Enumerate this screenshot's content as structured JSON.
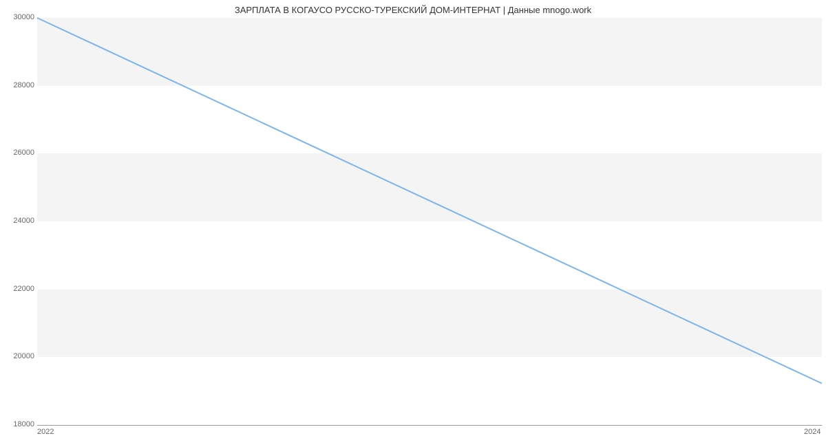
{
  "chart_data": {
    "type": "line",
    "title": "ЗАРПЛАТА В КОГАУСО РУССКО-ТУРЕКСКИЙ ДОМ-ИНТЕРНАТ | Данные mnogo.work",
    "xlabel": "",
    "ylabel": "",
    "x": [
      2022,
      2024
    ],
    "values": [
      30000,
      19226
    ],
    "xlim": [
      2022,
      2024
    ],
    "ylim": [
      18000,
      30000
    ],
    "y_ticks": [
      18000,
      20000,
      22000,
      24000,
      26000,
      28000,
      30000
    ],
    "x_ticks": [
      2022,
      2024
    ]
  }
}
